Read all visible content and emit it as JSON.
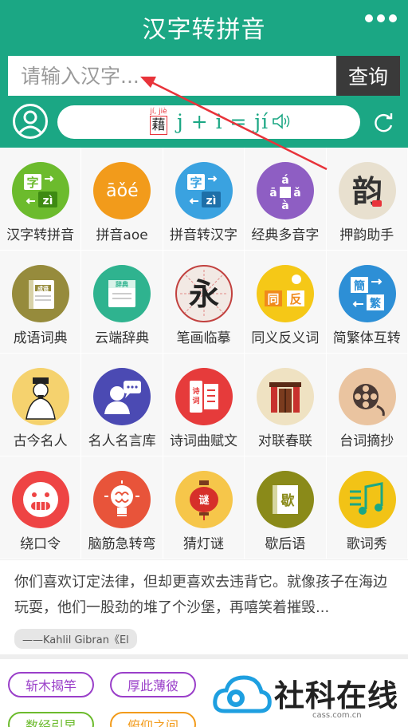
{
  "header": {
    "title": "汉字转拼音",
    "more_icon": "more-dots-icon"
  },
  "search": {
    "placeholder": "请输入汉字...",
    "button_label": "查询"
  },
  "demo": {
    "ruby_pinyin": "jí, jiè",
    "ruby_char": "藉",
    "formula": "j + i = jí",
    "speaker_icon": "speaker-icon"
  },
  "grid": [
    {
      "label": "汉字转拼音",
      "icon": "hanzi-to-pinyin-icon",
      "color": "#6cbb2d"
    },
    {
      "label": "拼音aoe",
      "icon": "pinyin-aoe-icon",
      "color": "#f29b1b"
    },
    {
      "label": "拼音转汉字",
      "icon": "pinyin-to-hanzi-icon",
      "color": "#3aa2e0"
    },
    {
      "label": "经典多音字",
      "icon": "polyphone-icon",
      "color": "#8e5ec3"
    },
    {
      "label": "押韵助手",
      "icon": "rhyme-icon",
      "color": "#e8e0cf"
    },
    {
      "label": "成语词典",
      "icon": "idiom-dictionary-icon",
      "color": "#968b3c"
    },
    {
      "label": "云端辞典",
      "icon": "cloud-dictionary-icon",
      "color": "#2fb38f"
    },
    {
      "label": "笔画临摹",
      "icon": "stroke-copy-icon",
      "color": "#f2e9e4"
    },
    {
      "label": "同义反义词",
      "icon": "synonym-antonym-icon",
      "color": "#f5c817"
    },
    {
      "label": "简繁体互转",
      "icon": "simplified-traditional-icon",
      "color": "#2d8fd6"
    },
    {
      "label": "古今名人",
      "icon": "famous-people-icon",
      "color": "#f5d26e"
    },
    {
      "label": "名人名言库",
      "icon": "famous-quotes-icon",
      "color": "#4b4ab3"
    },
    {
      "label": "诗词曲赋文",
      "icon": "poetry-icon",
      "color": "#e63b3b"
    },
    {
      "label": "对联春联",
      "icon": "couplet-icon",
      "color": "#efe2c2"
    },
    {
      "label": "台词摘抄",
      "icon": "lines-excerpt-icon",
      "color": "#eac4a0"
    },
    {
      "label": "绕口令",
      "icon": "tongue-twister-icon",
      "color": "#ee4444"
    },
    {
      "label": "脑筋急转弯",
      "icon": "brain-teaser-icon",
      "color": "#e8543a"
    },
    {
      "label": "猜灯谜",
      "icon": "lantern-riddle-icon",
      "color": "#f6c64a"
    },
    {
      "label": "歇后语",
      "icon": "xiehouyu-icon",
      "color": "#8a8a19"
    },
    {
      "label": "歌词秀",
      "icon": "lyrics-icon",
      "color": "#f2c316"
    }
  ],
  "quote": {
    "text": "你们喜欢订定法律，但却更喜欢去违背它。就像孩子在海边玩耍，他们一股劲的堆了个沙堡，再嘻笑着摧毁...",
    "author": "——Kahlil Gibran《El"
  },
  "idioms": [
    {
      "label": "斩木揭竿"
    },
    {
      "label": "厚此薄彼"
    },
    {
      "label": "数经引早"
    },
    {
      "label": "俯仰之间"
    }
  ],
  "watermark": {
    "title": "社科在线",
    "subtitle": "cass.com.cn"
  },
  "colors": {
    "brand": "#1ba784",
    "dark": "#3a3a3a",
    "annotation_arrow": "#e8333a"
  }
}
